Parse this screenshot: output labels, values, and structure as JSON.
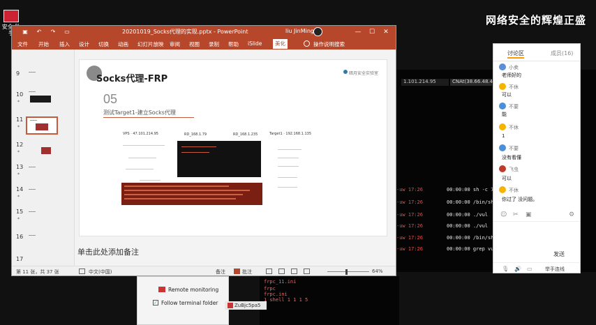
{
  "desktop": {
    "icon_label": "安全 助手",
    "watermark": "网络安全的辉煌正盛",
    "desktop_small_label": "S"
  },
  "ppt": {
    "title": "20201019_Socks代理的实现.pptx - PowerPoint",
    "user": "liu JinMing",
    "quick_access": [
      "save-icon",
      "undo-icon",
      "redo-icon",
      "present-icon"
    ],
    "window_buttons": [
      "—",
      "☐",
      "✕"
    ],
    "ribbon_tabs": [
      "文件",
      "开始",
      "插入",
      "设计",
      "切换",
      "动画",
      "幻灯片放映",
      "审阅",
      "视图",
      "录制",
      "帮助",
      "iSlide",
      "美化",
      "操作说明搜索"
    ],
    "active_tab": "美化",
    "thumbnails": [
      {
        "num": "9",
        "star": ""
      },
      {
        "num": "10",
        "star": "*"
      },
      {
        "num": "11",
        "star": "*"
      },
      {
        "num": "12",
        "star": "*"
      },
      {
        "num": "13",
        "star": "*"
      },
      {
        "num": "14",
        "star": "*"
      },
      {
        "num": "15",
        "star": "*"
      },
      {
        "num": "16",
        "star": ""
      },
      {
        "num": "17",
        "star": ""
      }
    ],
    "slide": {
      "title": "Socks代理-FRP",
      "number": "05",
      "subtitle": "测试Target1-建立Socks代理",
      "logo": "暗月安全实验室",
      "labels": {
        "vps": "VPS · 47.101.214.95",
        "target": "Target1 · 192.168.1.135",
        "box2": "RD_168.1.79",
        "box3": "RD_168.1.235"
      }
    },
    "notes_placeholder": "单击此处添加备注",
    "status": {
      "slide_info": "第 11 张，共 37 张",
      "language": "中文(中国)",
      "notes": "备注",
      "comments": "批注",
      "zoom": "64%"
    }
  },
  "terminal": {
    "tabs": [
      "1.101.214.95",
      "CNAt(38.66.48.43)"
    ],
    "lines_red": [
      "-uw 17:26",
      "-uw 17:26",
      "-uw 17:26",
      "-uw 17:26",
      "-uw 17:26",
      "-uw 17:26"
    ],
    "lines_white": [
      "00:00:00 sh -c 7715",
      "00:00:00 /bin/sh",
      "00:00:00 ./vul",
      "00:00:00 ./vul",
      "00:00:00 /bin/sh",
      "00:00:00 grep vu"
    ],
    "bottom_lines": [
      "frpc_11.ini",
      "frpc",
      "frpc.ini",
      "1 shell 1 1 1 5"
    ]
  },
  "remote_panel": {
    "remote_label": "Remote monitoring",
    "follow_label": "Follow terminal folder",
    "tab_label": "ZuBjc5pa5",
    "checked": true
  },
  "chat": {
    "tab_active": "讨论区",
    "tab_inactive": "成员(16)",
    "messages": [
      {
        "name": "小卖",
        "text": "老师好的",
        "color": "#5b8fd6"
      },
      {
        "name": "不休",
        "text": "可以",
        "color": "#f6b400"
      },
      {
        "name": "不要",
        "text": "能",
        "color": "#4a90d9"
      },
      {
        "name": "不休",
        "text": "1",
        "color": "#f6b400"
      },
      {
        "name": "不要",
        "text": "没有看懂",
        "color": "#4a90d9"
      },
      {
        "name": "飞虫",
        "text": "可以",
        "color": "#c0392b"
      },
      {
        "name": "不休",
        "text": "你过了 没问题。",
        "color": "#f6b400"
      }
    ],
    "send_label": "发送",
    "mic_label": "举手连线"
  }
}
